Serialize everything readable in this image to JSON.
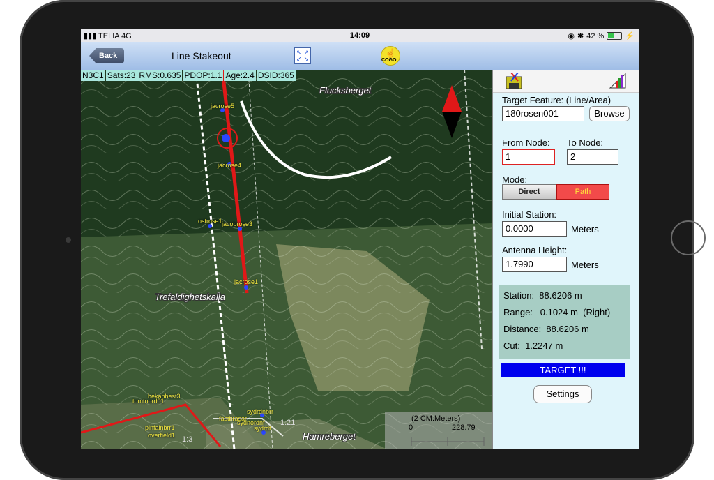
{
  "status_bar": {
    "carrier": "TELIA",
    "network": "4G",
    "time": "14:09",
    "battery_percent": "42 %",
    "battery_level": 0.42
  },
  "nav": {
    "back_label": "Back",
    "title": "Line Stakeout",
    "cogo_label": "COGO"
  },
  "gps": {
    "fix": "N3C1",
    "sats": "Sats:23",
    "rms": "RMS:0.635",
    "pdop": "PDOP:1.1",
    "age": "Age:2.4",
    "dsid": "DSID:365"
  },
  "map": {
    "places": {
      "fluck": "Flucksberget",
      "tref": "Trefaldighetskalla",
      "hamre": "Hamreberget"
    },
    "nodes": {
      "jacrose5": "jacrose5",
      "jacrose4": "jacrose4",
      "ostrose1": "ostrose1",
      "jacobrose3": "jacobrose3",
      "jacrose1": "jacrose1",
      "bekanhest3": "bekanhest3",
      "tomtnord01": "tomtnord01",
      "sydrdnbrr": "sydrdnbrr",
      "fastbrasar": "fastbrasar",
      "sydnordnf": "sydnordnf",
      "sydrdf": "sydrdf",
      "pinfalnbrr1": "pinfalnbrr1",
      "overfield1": "overfield1"
    },
    "ratio_1": "1:3",
    "ratio_2": "1:21",
    "scale_label": "(2 CM:Meters)",
    "scale_min": "0",
    "scale_max": "228.79"
  },
  "panel": {
    "target_feature_label": "Target Feature: (Line/Area)",
    "target_feature_value": "180rosen001",
    "browse_label": "Browse",
    "from_node_label": "From Node:",
    "from_node_value": "1",
    "to_node_label": "To Node:",
    "to_node_value": "2",
    "mode_label": "Mode:",
    "mode_direct": "Direct",
    "mode_path": "Path",
    "initial_station_label": "Initial Station:",
    "initial_station_value": "0.0000",
    "initial_station_unit": "Meters",
    "antenna_height_label": "Antenna Height:",
    "antenna_height_value": "1.7990",
    "antenna_height_unit": "Meters",
    "station": "Station:  88.6206 m",
    "range": "Range:   0.1024 m  (Right)",
    "distance": "Distance:  88.6206 m",
    "cut": "Cut:  1.2247 m",
    "target": "TARGET !!!",
    "settings": "Settings"
  },
  "colors": {
    "accent_red": "#f24a4a",
    "target_blue": "#0000ee",
    "panel_bg": "#e0f5fb",
    "info_bg": "#a7cdc4",
    "gps_bg": "#a9e7dd",
    "node_label": "#f2e640"
  }
}
